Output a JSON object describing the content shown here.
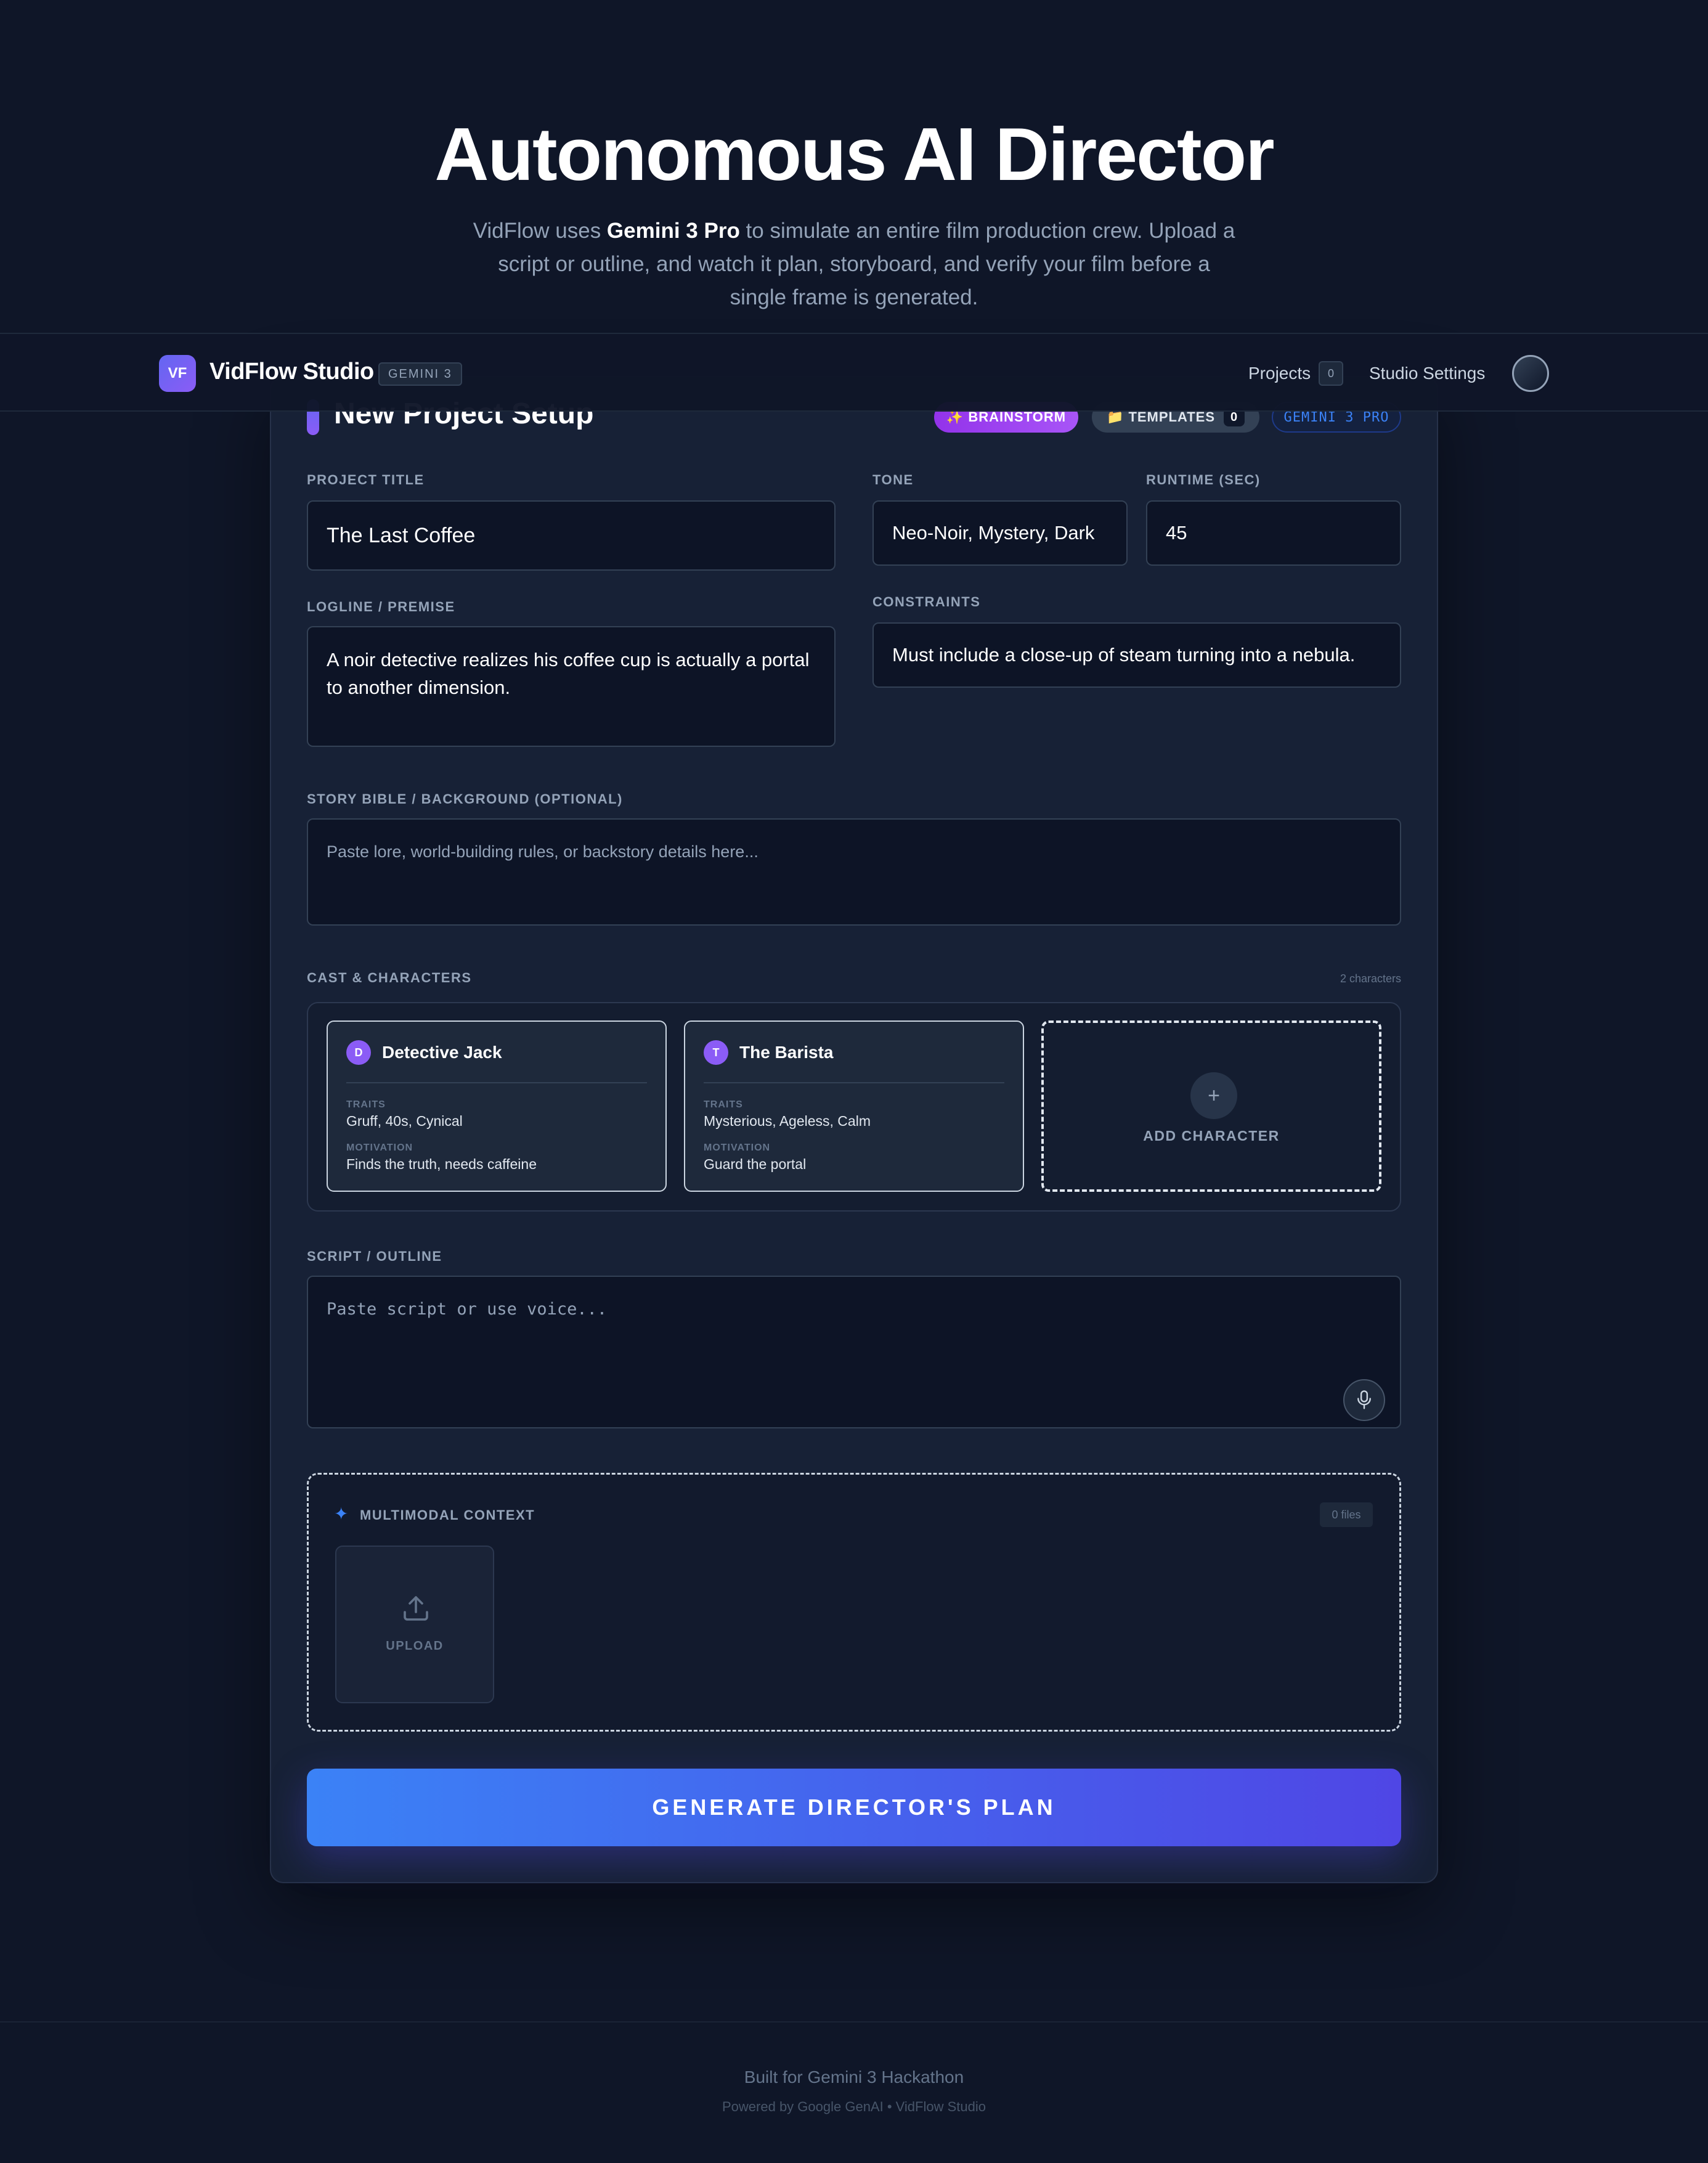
{
  "hero": {
    "title": "Autonomous AI Director",
    "subtitle_pre": "VidFlow uses ",
    "subtitle_bold": "Gemini 3 Pro",
    "subtitle_post": " to simulate an entire film production crew. Upload a script or outline, and watch it plan, storyboard, and verify your film before a single frame is generated."
  },
  "nav": {
    "logo": "VF",
    "brand": "VidFlow Studio",
    "badge": "GEMINI 3",
    "projects_label": "Projects",
    "projects_count": "0",
    "settings_label": "Studio Settings"
  },
  "card": {
    "title": "New Project Setup",
    "brainstorm": "✨ BRAINSTORM",
    "templates": "📁 TEMPLATES",
    "templates_count": "0",
    "model_badge": "GEMINI 3 PRO"
  },
  "form": {
    "project_title_label": "PROJECT TITLE",
    "project_title_value": "The Last Coffee",
    "tone_label": "TONE",
    "tone_value": "Neo-Noir, Mystery, Dark",
    "runtime_label": "RUNTIME (SEC)",
    "runtime_value": "45",
    "logline_label": "LOGLINE / PREMISE",
    "logline_value": "A noir detective realizes his coffee cup is actually a portal to another dimension.",
    "constraints_label": "CONSTRAINTS",
    "constraints_value": "Must include a close-up of steam turning into a nebula.",
    "story_bible_label": "STORY BIBLE / BACKGROUND (OPTIONAL)",
    "story_bible_placeholder": "Paste lore, world-building rules, or backstory details here...",
    "script_label": "SCRIPT / OUTLINE",
    "script_placeholder": "Paste script or use voice..."
  },
  "cast": {
    "label": "CAST & CHARACTERS",
    "count": "2 characters",
    "characters": [
      {
        "initial": "D",
        "name": "Detective Jack",
        "traits_label": "TRAITS",
        "traits": "Gruff, 40s, Cynical",
        "motivation_label": "MOTIVATION",
        "motivation": "Finds the truth, needs caffeine"
      },
      {
        "initial": "T",
        "name": "The Barista",
        "traits_label": "TRAITS",
        "traits": "Mysterious, Ageless, Calm",
        "motivation_label": "MOTIVATION",
        "motivation": "Guard the portal"
      }
    ],
    "add_plus": "+",
    "add_label": "ADD CHARACTER"
  },
  "multimodal": {
    "icon": "✦",
    "label": "MULTIMODAL CONTEXT",
    "count": "0 files",
    "upload_label": "UPLOAD"
  },
  "generate_label": "GENERATE DIRECTOR'S PLAN",
  "footer": {
    "line1": "Built for Gemini 3 Hackathon",
    "line2": "Powered by Google GenAI • VidFlow Studio"
  },
  "colors": {
    "background": "#0f1628",
    "accent": "#4f46e5",
    "brainstorm": "#a855f7",
    "gemini": "#3b82f6"
  }
}
